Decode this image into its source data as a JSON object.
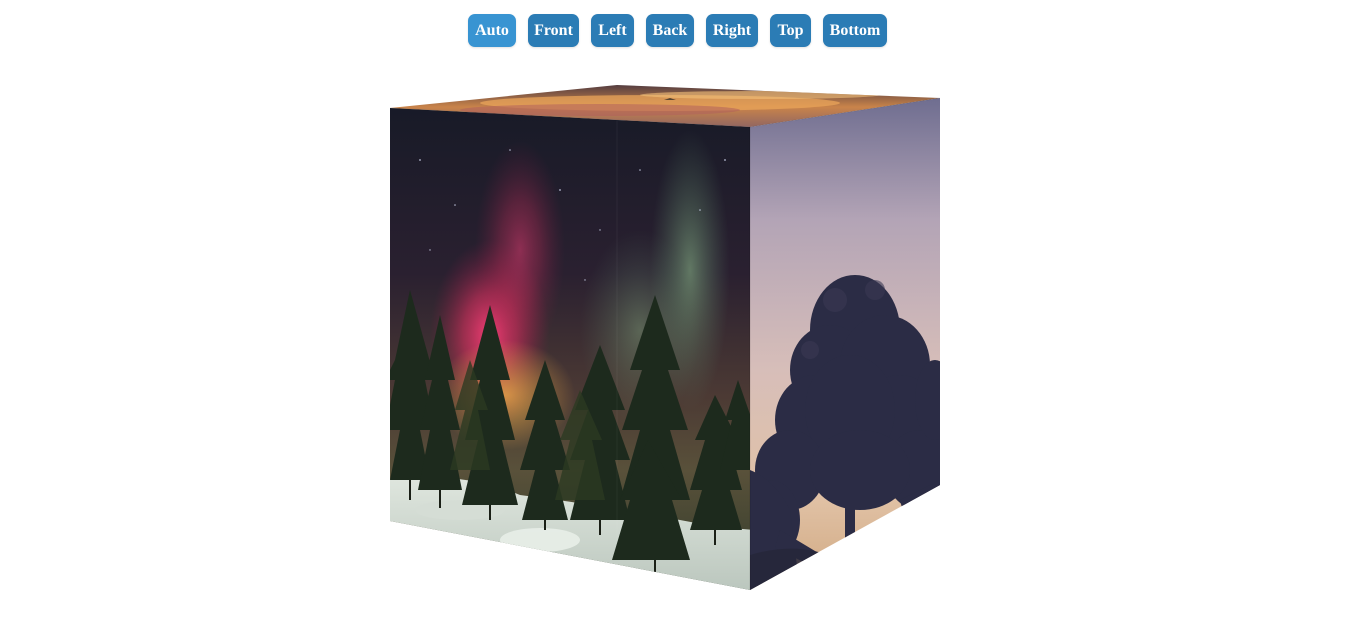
{
  "toolbar": {
    "buttons": [
      {
        "id": "auto",
        "label": "Auto",
        "active": true
      },
      {
        "id": "front",
        "label": "Front",
        "active": false
      },
      {
        "id": "left",
        "label": "Left",
        "active": false
      },
      {
        "id": "back",
        "label": "Back",
        "active": false
      },
      {
        "id": "right",
        "label": "Right",
        "active": false
      },
      {
        "id": "top",
        "label": "Top",
        "active": false
      },
      {
        "id": "bottom",
        "label": "Bottom",
        "active": false
      }
    ]
  },
  "cube": {
    "faces": {
      "front": "aurora-over-snowy-pine-forest-photo",
      "right": "tree-silhouette-at-dusk-photo",
      "top": "sunset-sky-photo"
    }
  },
  "colors": {
    "button": "#2b7cb5",
    "button_active": "#3894d2",
    "button_text": "#ffffff",
    "background": "#ffffff"
  }
}
